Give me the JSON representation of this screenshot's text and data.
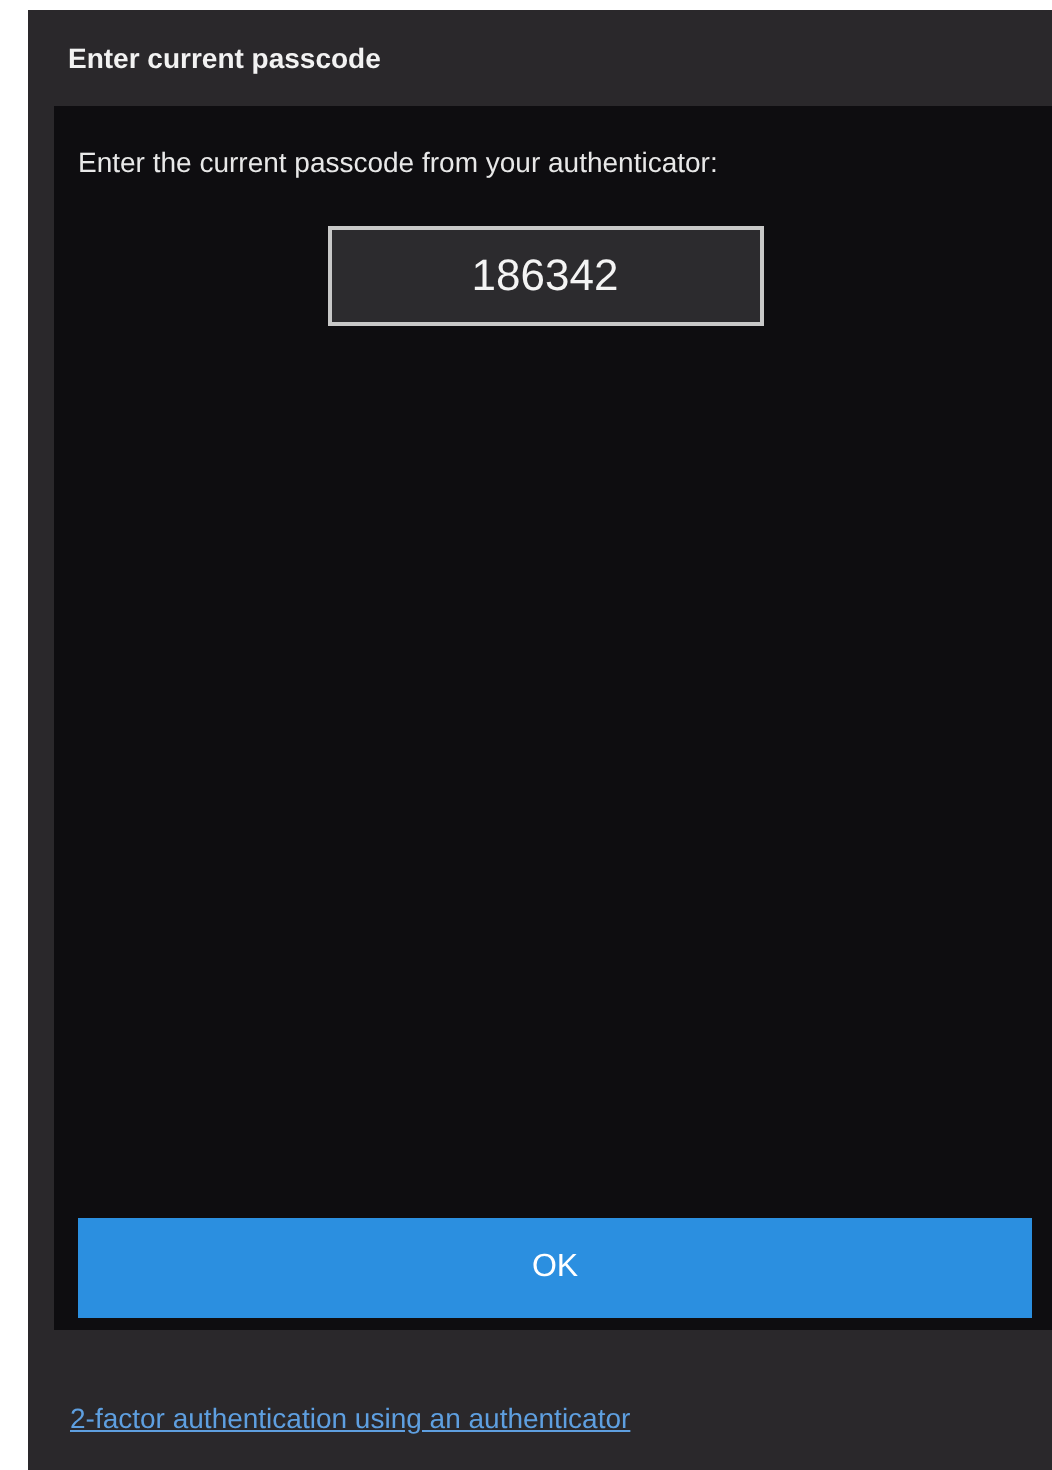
{
  "dialog": {
    "title": "Enter current passcode",
    "instruction": "Enter the current passcode from your authenticator:",
    "passcode_field": {
      "value": "186342"
    },
    "buttons": [
      "OK"
    ]
  },
  "footer": {
    "link": "2-factor authentication using an authenticator"
  }
}
